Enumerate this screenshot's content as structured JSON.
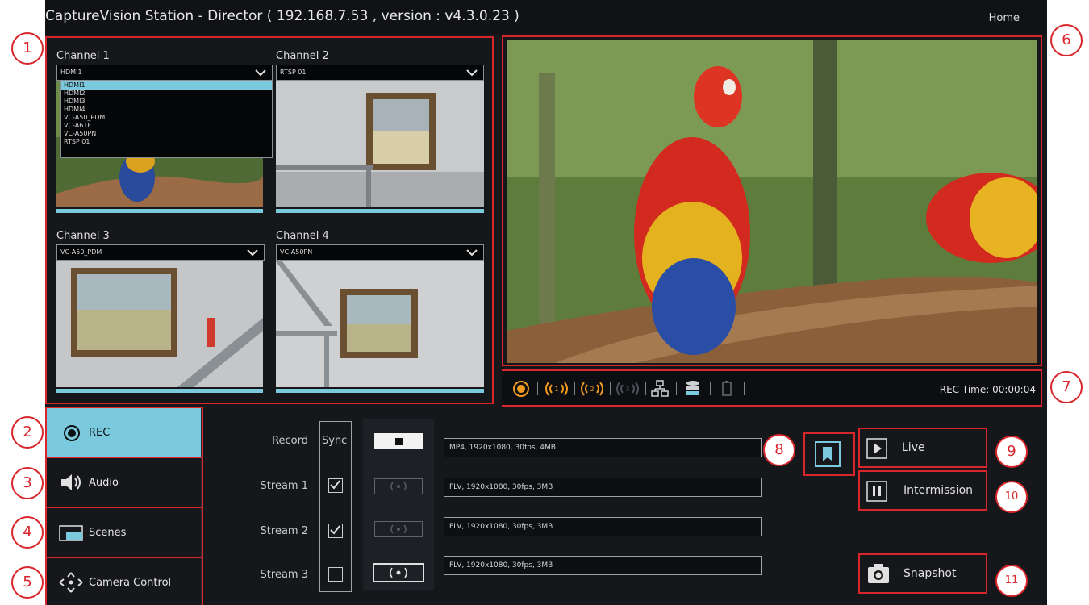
{
  "app": {
    "title": "CaptureVision Station - Director ( 192.168.7.53 , version : v4.3.0.23 )",
    "home": "Home"
  },
  "channels": [
    {
      "label": "Channel 1",
      "selected": "HDMI1"
    },
    {
      "label": "Channel 2",
      "selected": "RTSP 01"
    },
    {
      "label": "Channel 3",
      "selected": "VC-A50_PDM"
    },
    {
      "label": "Channel 4",
      "selected": "VC-A50PN"
    }
  ],
  "dropdown": {
    "options": [
      "HDMI1",
      "HDMI2",
      "HDMI3",
      "HDMI4",
      "VC-A50_PDM",
      "VC-A61F",
      "VC-A50PN",
      "RTSP 01"
    ],
    "selected_index": 0
  },
  "toolbar": {
    "icons": [
      "record-dot-icon",
      "stream-1-icon",
      "stream-2-icon",
      "stream-3-icon",
      "network-icon",
      "storage-icon",
      "battery-icon"
    ],
    "rec_time": "REC Time: 00:00:04"
  },
  "tabs": [
    {
      "label": "REC",
      "icon": "record-icon",
      "active": true
    },
    {
      "label": "Audio",
      "icon": "speaker-icon",
      "active": false
    },
    {
      "label": "Scenes",
      "icon": "scenes-icon",
      "active": false
    },
    {
      "label": "Camera Control",
      "icon": "ptz-arrows-icon",
      "active": false
    }
  ],
  "record_panel": {
    "sync_header": "Sync",
    "rows": [
      {
        "label": "Record",
        "synced": null,
        "info": "MP4, 1920x1080, 30fps, 4MB"
      },
      {
        "label": "Stream 1",
        "synced": true,
        "info": "FLV, 1920x1080, 30fps, 3MB"
      },
      {
        "label": "Stream 2",
        "synced": true,
        "info": "FLV, 1920x1080, 30fps, 3MB"
      },
      {
        "label": "Stream 3",
        "synced": false,
        "info": "FLV, 1920x1080, 30fps, 3MB"
      }
    ]
  },
  "buttons": {
    "live": "Live",
    "intermission": "Intermission",
    "snapshot": "Snapshot"
  },
  "callouts": [
    "1",
    "2",
    "3",
    "4",
    "5",
    "6",
    "7",
    "8",
    "9",
    "10",
    "11"
  ],
  "colors": {
    "accent": "#7ac9dc",
    "callout_red": "#d9262c",
    "background": "#15171b"
  }
}
